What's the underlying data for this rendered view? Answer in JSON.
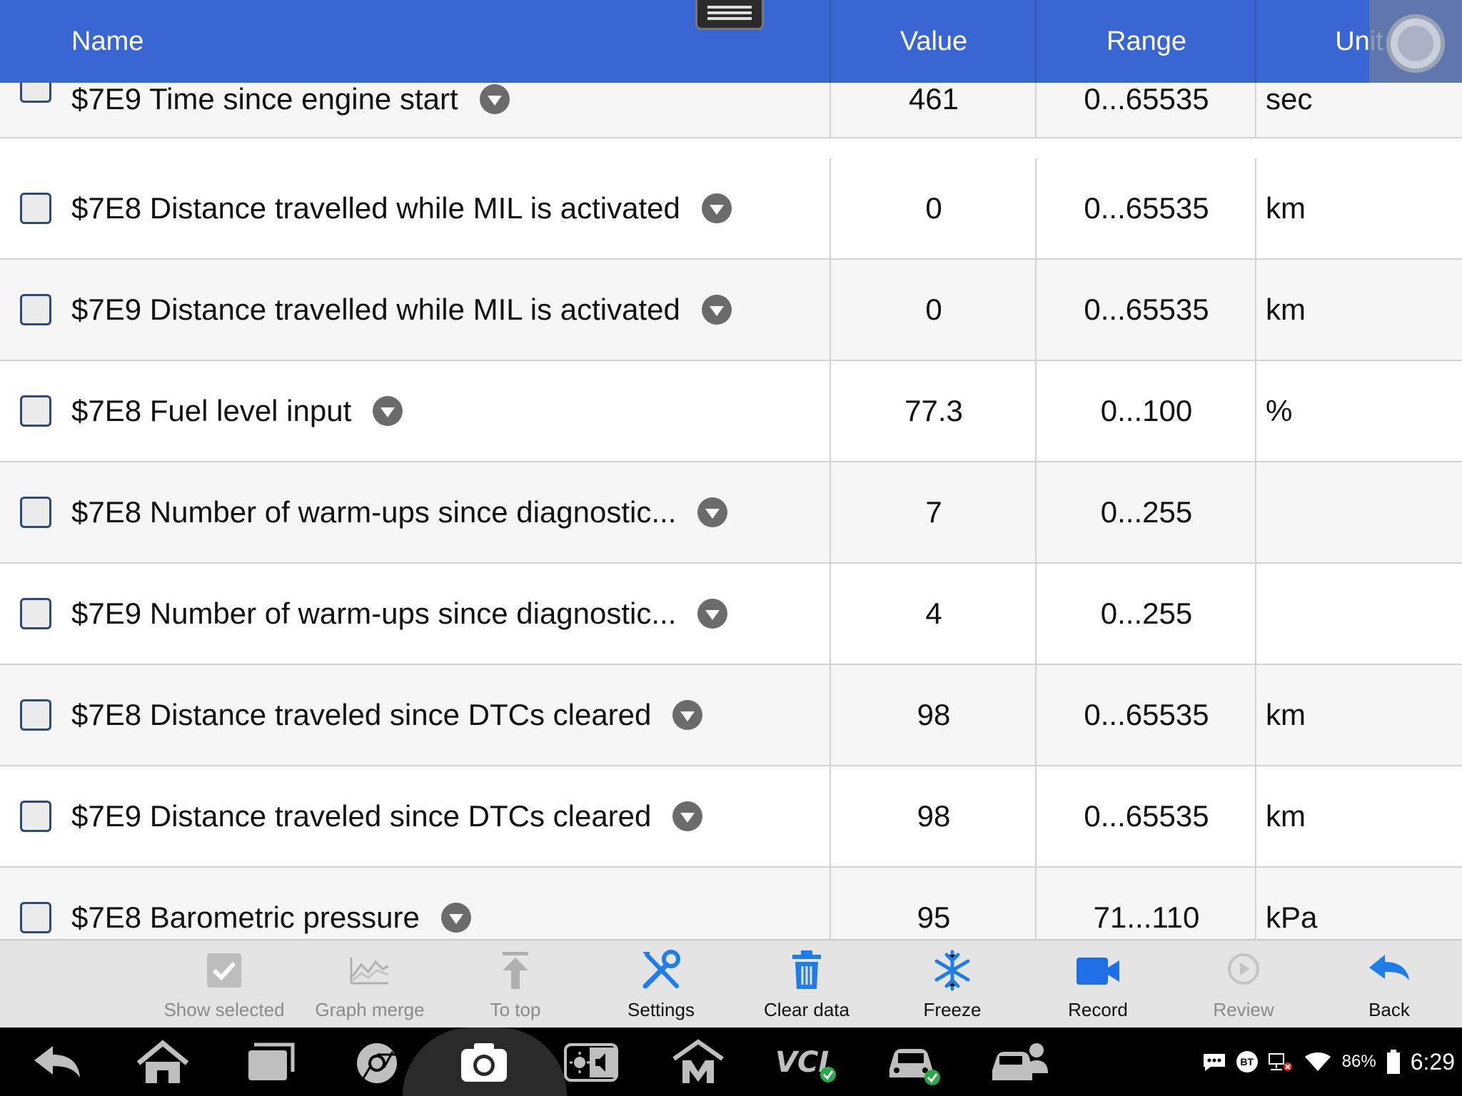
{
  "header": {
    "name": "Name",
    "value": "Value",
    "range": "Range",
    "unit": "Unit"
  },
  "rows": [
    {
      "name": "$7E9 Time since engine start",
      "value": "461",
      "range": "0...65535",
      "unit": "sec"
    },
    {
      "name": "$7E8 Distance travelled while MIL is activated",
      "value": "0",
      "range": "0...65535",
      "unit": "km"
    },
    {
      "name": "$7E9 Distance travelled while MIL is activated",
      "value": "0",
      "range": "0...65535",
      "unit": "km"
    },
    {
      "name": "$7E8 Fuel level input",
      "value": "77.3",
      "range": "0...100",
      "unit": "%"
    },
    {
      "name": "$7E8 Number of warm-ups since diagnostic...",
      "value": "7",
      "range": "0...255",
      "unit": ""
    },
    {
      "name": "$7E9 Number of warm-ups since diagnostic...",
      "value": "4",
      "range": "0...255",
      "unit": ""
    },
    {
      "name": "$7E8 Distance traveled since DTCs cleared",
      "value": "98",
      "range": "0...65535",
      "unit": "km"
    },
    {
      "name": "$7E9 Distance traveled since DTCs cleared",
      "value": "98",
      "range": "0...65535",
      "unit": "km"
    },
    {
      "name": "$7E8 Barometric pressure",
      "value": "95",
      "range": "71...110",
      "unit": "kPa"
    }
  ],
  "toolbar": {
    "show_selected": "Show selected",
    "graph_merge": "Graph merge",
    "to_top": "To top",
    "settings": "Settings",
    "clear_data": "Clear data",
    "freeze": "Freeze",
    "record": "Record",
    "review": "Review",
    "back": "Back"
  },
  "status": {
    "bt": "BT",
    "battery": "86%",
    "time": "6:29"
  },
  "colors": {
    "header_bg": "#3a66d4",
    "accent_blue": "#1f7de8",
    "record_blue": "#1e6fe6"
  }
}
